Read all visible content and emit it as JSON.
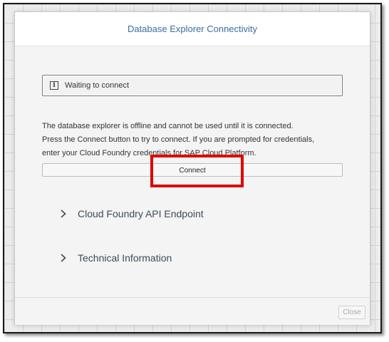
{
  "dialog": {
    "title": "Database Explorer Connectivity"
  },
  "status": {
    "icon": "info-icon",
    "text": "Waiting to connect"
  },
  "description": {
    "lines": [
      "The database explorer is offline and cannot be used until it is connected.",
      "Press the Connect button to try to connect. If you are prompted for credentials,",
      "enter your Cloud Foundry credentials for SAP Cloud Platform."
    ]
  },
  "connect_button": {
    "label": "Connect"
  },
  "sections": [
    {
      "label": "Cloud Foundry API Endpoint",
      "icon": "chevron-right-icon"
    },
    {
      "label": "Technical Information",
      "icon": "chevron-right-icon"
    }
  ],
  "footer": {
    "close_label": "Close"
  },
  "colors": {
    "title": "#3a6ea5",
    "highlight": "#e00000"
  }
}
